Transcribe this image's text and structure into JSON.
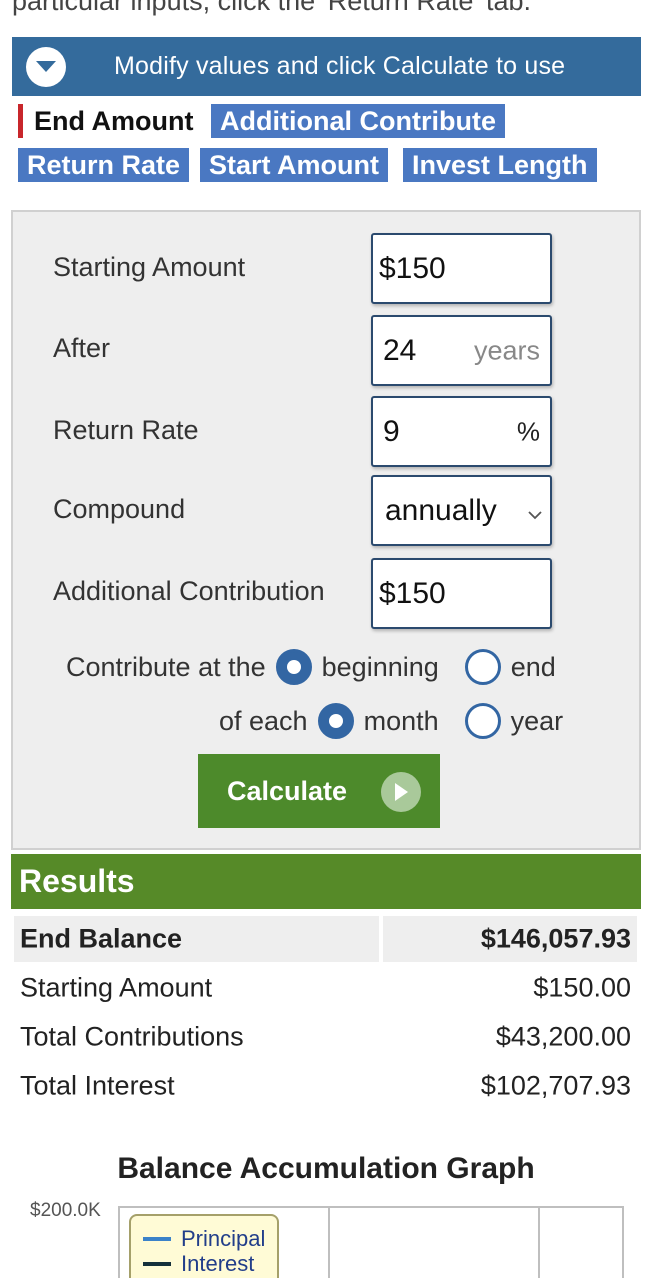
{
  "intro": {
    "text": "particular inputs, click the 'Return Rate' tab."
  },
  "banner": {
    "text": "Modify values and click Calculate to use",
    "icon": "chevron-down-circle-icon"
  },
  "tabs": [
    {
      "label": "End Amount",
      "active": true
    },
    {
      "label": "Additional Contribute",
      "active": false
    },
    {
      "label": "Return Rate",
      "active": false
    },
    {
      "label": "Start Amount",
      "active": false
    },
    {
      "label": "Invest Length",
      "active": false
    }
  ],
  "form": {
    "starting_amount": {
      "label": "Starting Amount",
      "value": "$150"
    },
    "after": {
      "label": "After",
      "value": "24",
      "suffix": "years"
    },
    "return_rate": {
      "label": "Return Rate",
      "value": "9",
      "suffix": "%"
    },
    "compound": {
      "label": "Compound",
      "value": "annually"
    },
    "additional_contribution": {
      "label": "Additional Contribution",
      "value": "$150"
    },
    "contribute_at": {
      "label": "Contribute at the",
      "options": [
        "beginning",
        "end"
      ],
      "selected": "beginning"
    },
    "each": {
      "label": "of each",
      "options": [
        "month",
        "year"
      ],
      "selected": "month"
    },
    "calculate_label": "Calculate"
  },
  "results": {
    "title": "Results",
    "rows": [
      {
        "label": "End Balance",
        "value": "$146,057.93",
        "highlight": true
      },
      {
        "label": "Starting Amount",
        "value": "$150.00"
      },
      {
        "label": "Total Contributions",
        "value": "$43,200.00"
      },
      {
        "label": "Total Interest",
        "value": "$102,707.93"
      }
    ]
  },
  "graph": {
    "title": "Balance Accumulation Graph",
    "y_tick": "$200.0K",
    "legend": [
      {
        "name": "Principal",
        "color": "#3b82c9"
      },
      {
        "name": "Interest",
        "color": "#15303a"
      }
    ]
  },
  "colors": {
    "banner": "#346b9c",
    "tab": "#4a78c2",
    "accent_red": "#c8262b",
    "calculate": "#4d8a2b",
    "results": "#568a28",
    "radio": "#3366a3"
  }
}
